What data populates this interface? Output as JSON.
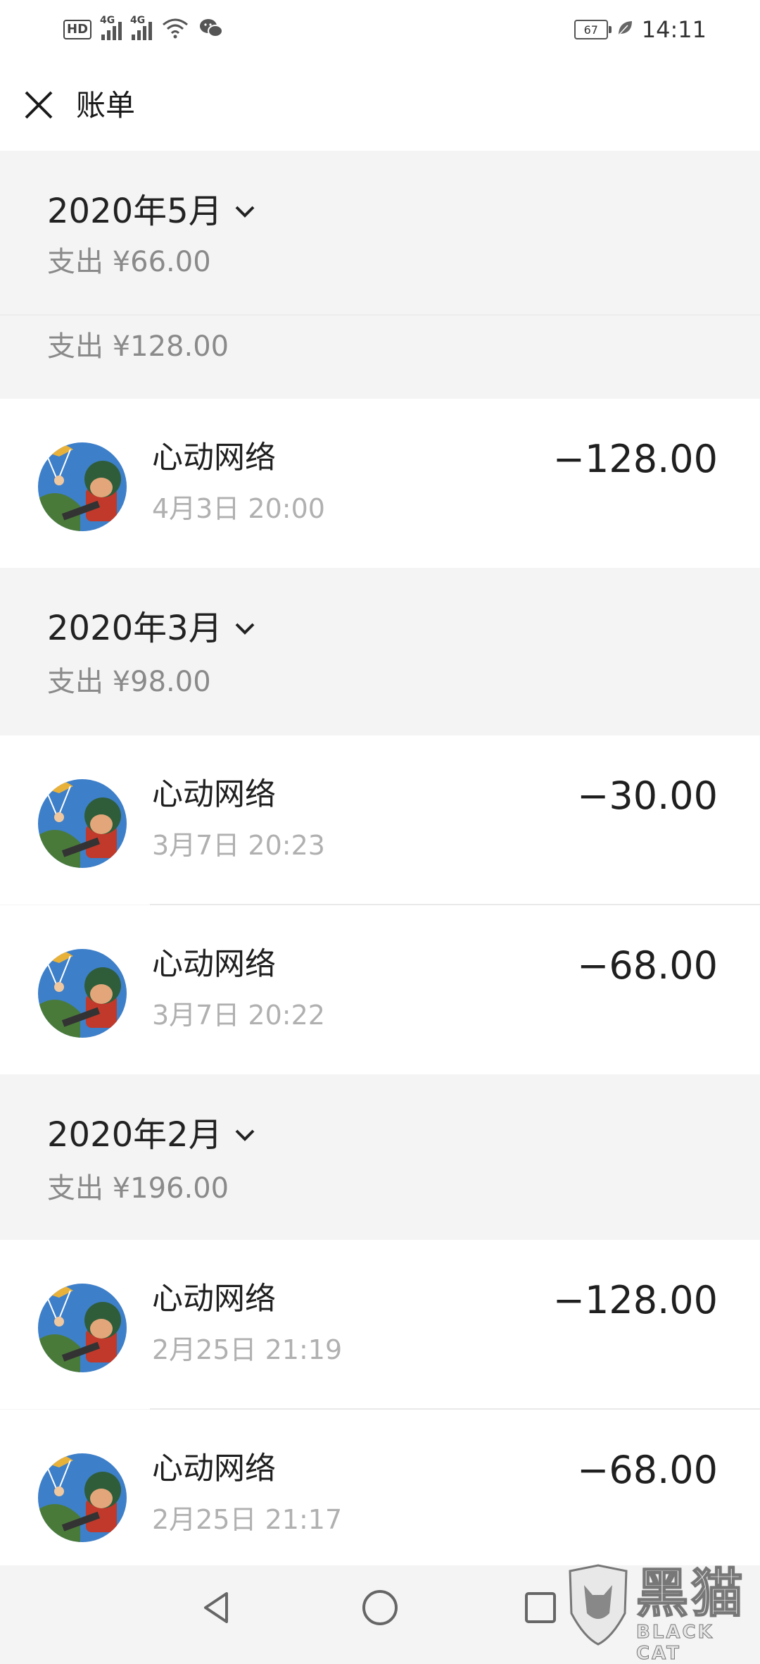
{
  "status_bar": {
    "hd_label": "HD",
    "net1": "4G",
    "net2": "4G",
    "battery": "67",
    "time": "14:11"
  },
  "header": {
    "title": "账单",
    "close_icon": "close-icon"
  },
  "months": [
    {
      "title": "2020年5月",
      "total": "支出 ¥66.00"
    },
    {
      "title": "",
      "total": "支出 ¥128.00"
    },
    {
      "title": "2020年3月",
      "total": "支出 ¥98.00"
    },
    {
      "title": "2020年2月",
      "total": "支出 ¥196.00"
    }
  ],
  "transactions": [
    {
      "merchant": "心动网络",
      "time": "4月3日 20:00",
      "amount": "−128.00"
    },
    {
      "merchant": "心动网络",
      "time": "3月7日 20:23",
      "amount": "−30.00"
    },
    {
      "merchant": "心动网络",
      "time": "3月7日 20:22",
      "amount": "−68.00"
    },
    {
      "merchant": "心动网络",
      "time": "2月25日 21:19",
      "amount": "−128.00"
    },
    {
      "merchant": "心动网络",
      "time": "2月25日 21:17",
      "amount": "−68.00"
    }
  ],
  "nav": {
    "back_icon": "back-triangle-icon",
    "home_icon": "home-circle-icon",
    "recents_icon": "recents-square-icon"
  },
  "watermark": {
    "text": "黑猫",
    "sub": "BLACK CAT"
  },
  "colors": {
    "background": "#f4f4f4",
    "card": "#ffffff",
    "muted_text": "#8a8a8a",
    "time_text": "#b0b0b0"
  }
}
